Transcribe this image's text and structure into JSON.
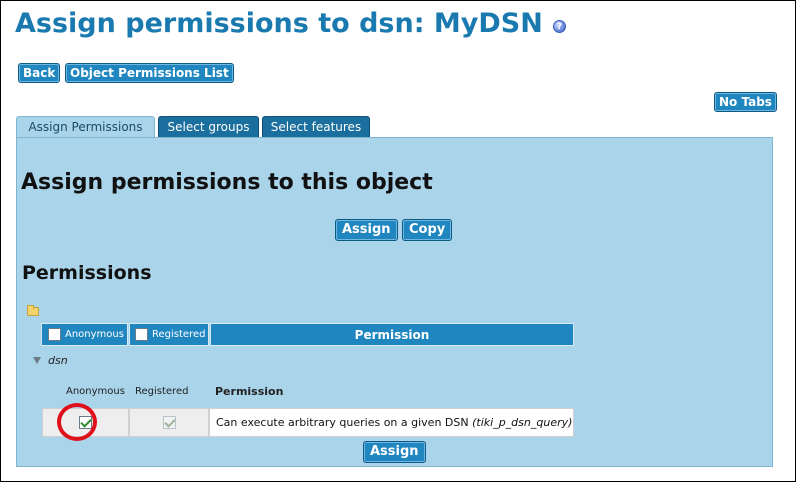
{
  "page": {
    "title": "Assign permissions to dsn: MyDSN",
    "help_icon": "help-icon"
  },
  "toolbar": {
    "back_label": "Back",
    "object_permissions_label": "Object Permissions List",
    "no_tabs_label": "No Tabs"
  },
  "tabs": [
    {
      "label": "Assign Permissions",
      "active": true
    },
    {
      "label": "Select groups",
      "active": false
    },
    {
      "label": "Select features",
      "active": false
    }
  ],
  "panel": {
    "heading": "Assign permissions to this object",
    "assign_label": "Assign",
    "copy_label": "Copy",
    "permissions_heading": "Permissions"
  },
  "table": {
    "header": {
      "col_anonymous": "Anonymous",
      "col_registered": "Registered",
      "col_permission": "Permission"
    },
    "group": {
      "name": "dsn",
      "sub_header": {
        "anonymous": "Anonymous",
        "registered": "Registered",
        "permission": "Permission"
      },
      "rows": [
        {
          "anonymous_checked": true,
          "registered_checked": true,
          "description": "Can execute arbitrary queries on a given DSN",
          "perm_name": "(tiki_p_dsn_query)"
        }
      ]
    },
    "bottom_assign_label": "Assign"
  },
  "colors": {
    "title": "#1a7ab0",
    "button": "#1f86c0",
    "tab": "#1b6f9e",
    "panel": "#a9d4ea",
    "highlight": "#e0101a"
  }
}
